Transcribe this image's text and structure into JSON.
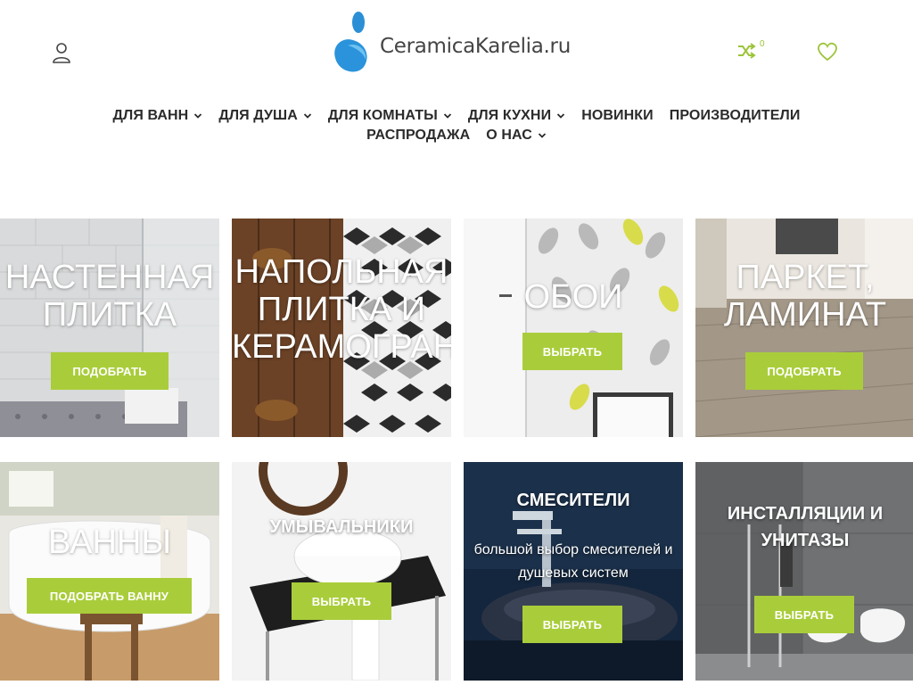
{
  "header": {
    "logo_text": "CeramicaKarelia.ru",
    "compare_count": "0"
  },
  "nav": {
    "items": [
      {
        "label": "ДЛЯ ВАНН",
        "dropdown": true
      },
      {
        "label": "ДЛЯ ДУША",
        "dropdown": true
      },
      {
        "label": "ДЛЯ КОМНАТЫ",
        "dropdown": true
      },
      {
        "label": "ДЛЯ КУХНИ",
        "dropdown": true
      },
      {
        "label": "НОВИНКИ",
        "dropdown": false
      },
      {
        "label": "ПРОИЗВОДИТЕЛИ",
        "dropdown": false
      },
      {
        "label": "РАСПРОДАЖА",
        "dropdown": false
      },
      {
        "label": "О НАС",
        "dropdown": true
      }
    ]
  },
  "tiles": [
    {
      "title": "НАСТЕННАЯ ПЛИТКА",
      "button": "ПОДОБРАТЬ"
    },
    {
      "title": "НАПОЛЬНАЯ ПЛИТКА И КЕРАМОГРАНИТ",
      "button": ""
    },
    {
      "title": "ОБОИ",
      "button": "ВЫБРАТЬ"
    },
    {
      "title": "ПАРКЕТ, ЛАМИНАТ",
      "button": "ПОДОБРАТЬ"
    },
    {
      "title": "ВАННЫ",
      "button": "ПОДОБРАТЬ ВАННУ"
    },
    {
      "title": "УМЫВАЛЬНИКИ",
      "button": "ВЫБРАТЬ"
    },
    {
      "title": "СМЕСИТЕЛИ",
      "subtitle": "большой выбор смесителей и душевых систем",
      "button": "ВЫБРАТЬ"
    },
    {
      "title": "ИНСТАЛЛЯЦИИ И УНИТАЗЫ",
      "button": "ВЫБРАТЬ"
    }
  ],
  "colors": {
    "accent": "#a9cd3a",
    "logo_blue": "#2b8fd6",
    "nav_text": "#2b2b2b"
  },
  "icons": {
    "user": "user-icon",
    "compare": "shuffle-icon",
    "wishlist": "heart-icon",
    "dropdown": "chevron-down-icon"
  }
}
